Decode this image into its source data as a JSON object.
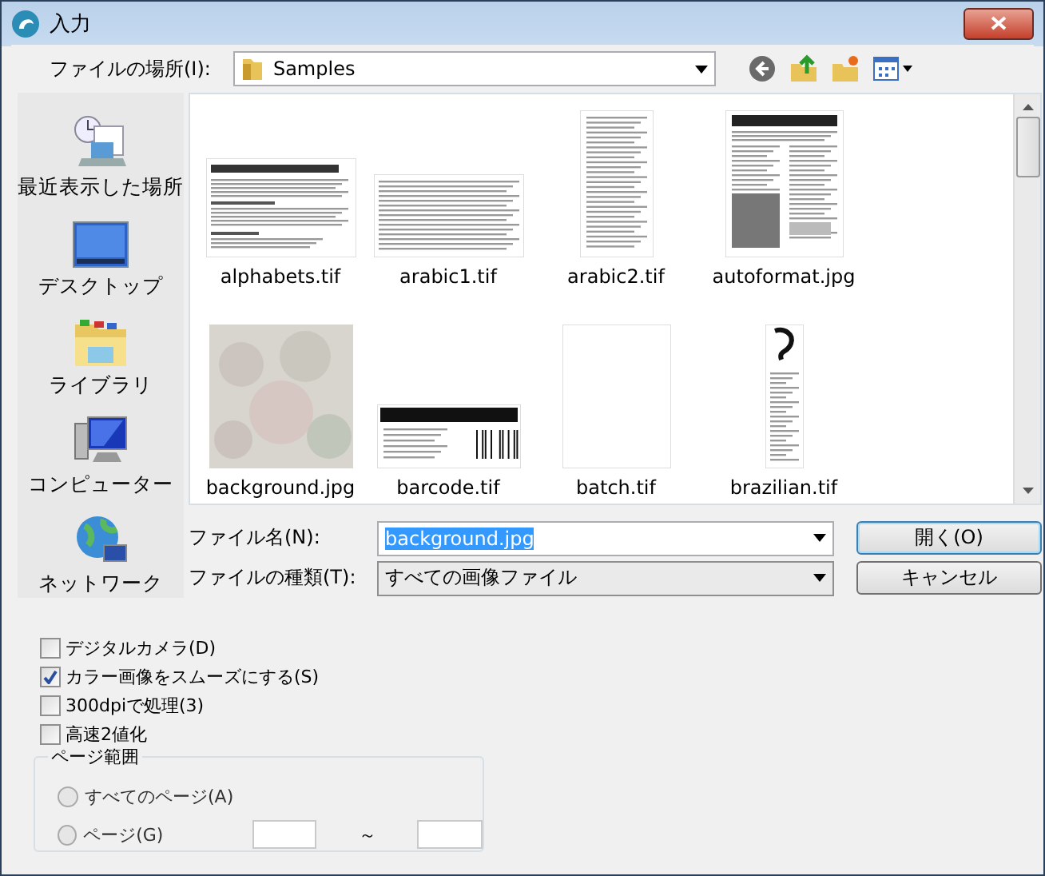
{
  "window": {
    "title": "入力"
  },
  "location": {
    "label": "ファイルの場所(I):",
    "value": "Samples"
  },
  "places": [
    {
      "label": "最近表示した場所",
      "kind": "recent"
    },
    {
      "label": "デスクトップ",
      "kind": "desktop"
    },
    {
      "label": "ライブラリ",
      "kind": "library"
    },
    {
      "label": "コンピューター",
      "kind": "computer"
    },
    {
      "label": "ネットワーク",
      "kind": "network"
    }
  ],
  "files": [
    {
      "name": "alphabets.tif",
      "kind": "wide-doc"
    },
    {
      "name": "arabic1.tif",
      "kind": "wide-script"
    },
    {
      "name": "arabic2.tif",
      "kind": "tall-script"
    },
    {
      "name": "autoformat.jpg",
      "kind": "article"
    },
    {
      "name": "background.jpg",
      "kind": "picture"
    },
    {
      "name": "barcode.tif",
      "kind": "barcode"
    },
    {
      "name": "batch.tif",
      "kind": "blank"
    },
    {
      "name": "brazilian.tif",
      "kind": "column"
    }
  ],
  "file_name": {
    "label": "ファイル名(N):",
    "value": "background.jpg",
    "highlighted": true
  },
  "file_type": {
    "label": "ファイルの種類(T):",
    "value": "すべての画像ファイル"
  },
  "buttons": [
    {
      "label": "開く(O)",
      "kind": "default"
    },
    {
      "label": "キャンセル",
      "kind": "normal"
    }
  ],
  "options": [
    {
      "label": "デジタルカメラ(D)",
      "checked": false
    },
    {
      "label": "カラー画像をスムーズにする(S)",
      "checked": true
    },
    {
      "label": "300dpiで処理(3)",
      "checked": false
    },
    {
      "label": "高速2値化",
      "checked": false
    }
  ],
  "page_range": {
    "title": "ページ範囲",
    "separator": "～",
    "options": [
      {
        "label": "すべてのページ(A)",
        "selected": false,
        "disabled": true
      },
      {
        "label": "ページ(G)",
        "selected": false,
        "disabled": true
      }
    ]
  }
}
